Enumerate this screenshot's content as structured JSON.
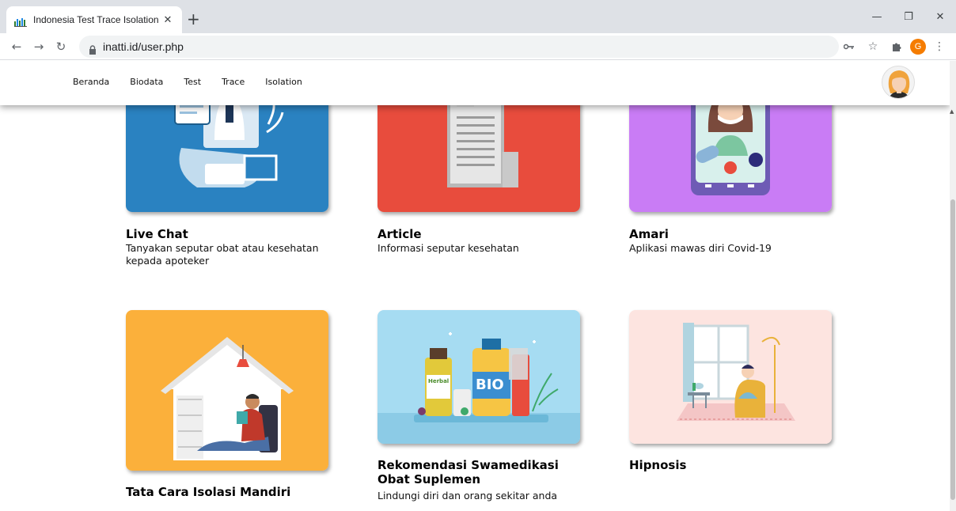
{
  "browser": {
    "tab_title": "Indonesia Test Trace Isolation",
    "url": "inatti.id/user.php",
    "profile_initial": "G"
  },
  "navbar": {
    "links": [
      "Beranda",
      "Biodata",
      "Test",
      "Trace",
      "Isolation"
    ]
  },
  "cards": [
    {
      "title": "Live Chat",
      "desc": "Tanyakan seputar obat atau kesehatan kepada apoteker",
      "color": "#2a82c1"
    },
    {
      "title": "Article",
      "desc": "Informasi seputar kesehatan",
      "color": "#e84c3d"
    },
    {
      "title": "Amari",
      "desc": "Aplikasi mawas diri Covid-19",
      "color": "#c97cf5"
    },
    {
      "title": "Tata Cara Isolasi Mandiri",
      "desc": "",
      "color": "#fbb03b"
    },
    {
      "title": "Rekomendasi Swamedikasi Obat Suplemen",
      "desc": "Lindungi diri dan orang sekitar anda",
      "color": "#a6dcf2"
    },
    {
      "title": "Hipnosis",
      "desc": "",
      "color": "#fde4e0"
    }
  ],
  "illustrations": {
    "bio_label": "BIO",
    "herbal_label": "Herbal"
  },
  "icons": {
    "back": "back-arrow-icon",
    "forward": "forward-arrow-icon",
    "reload": "reload-icon",
    "lock": "lock-icon",
    "key": "key-icon",
    "star": "star-icon",
    "extensions": "puzzle-icon",
    "menu": "kebab-menu-icon"
  }
}
